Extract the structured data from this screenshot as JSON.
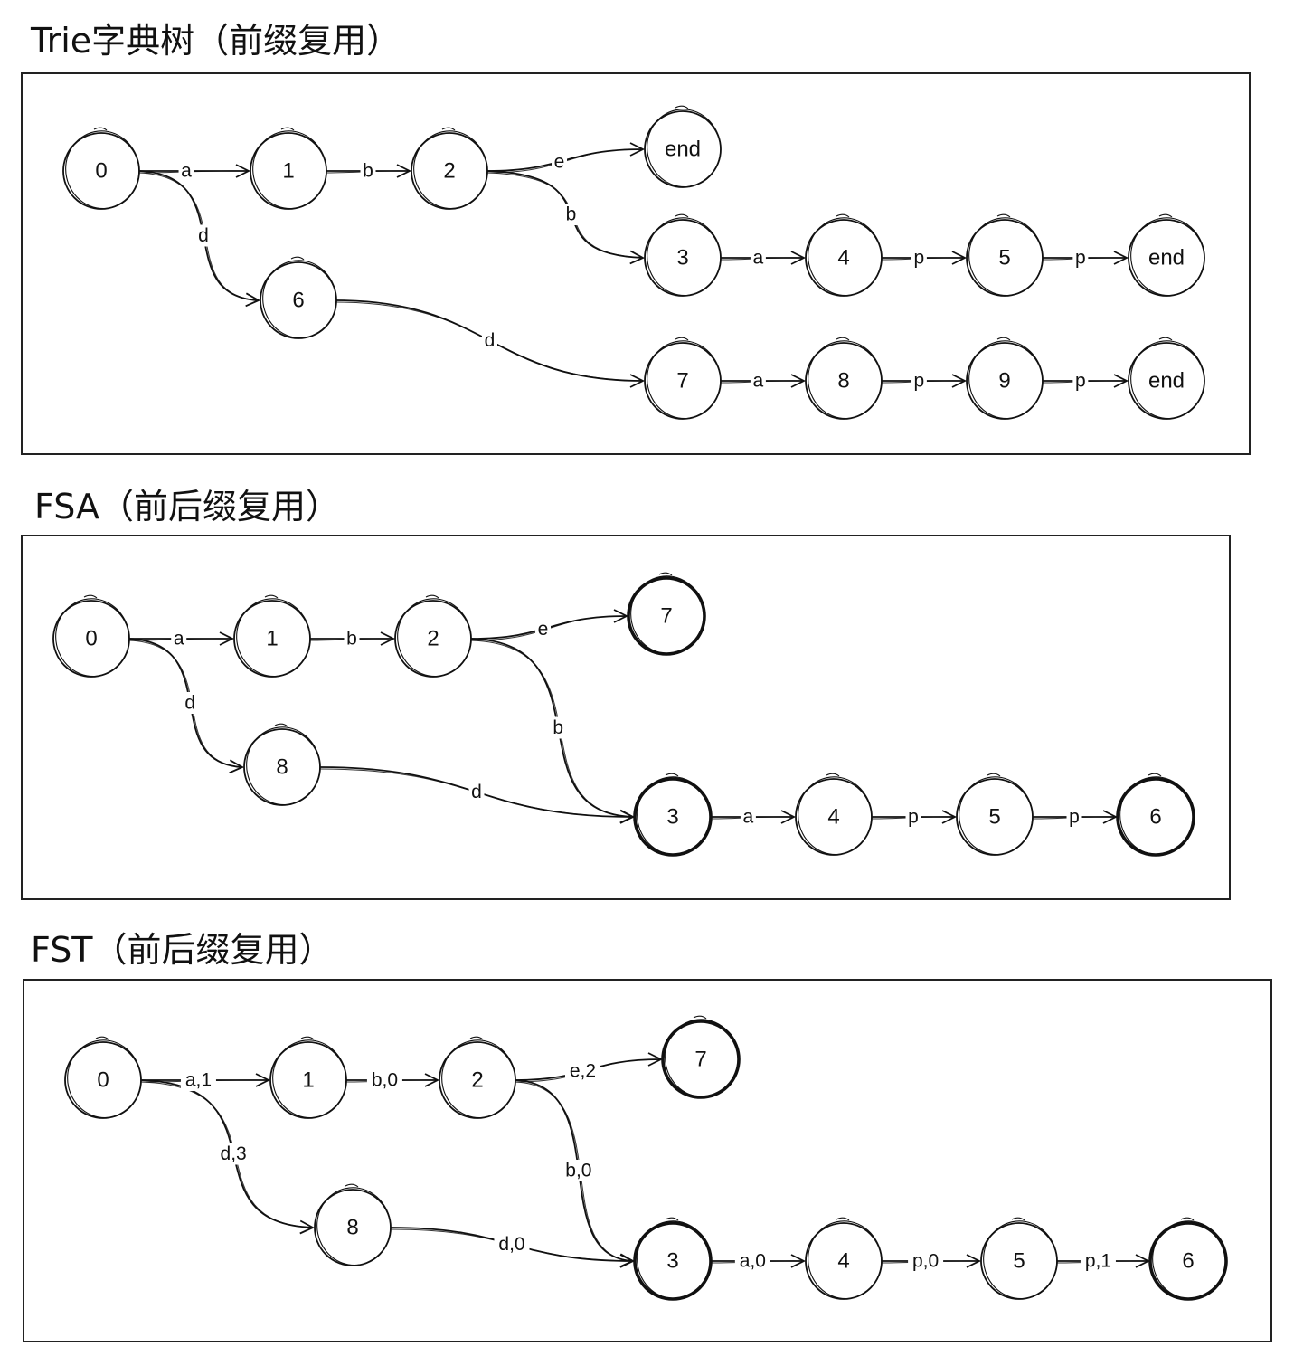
{
  "panels": [
    {
      "title": "Trie字典树（前缀复用）",
      "nodes": [
        {
          "id": "n0",
          "label": "0",
          "final": false
        },
        {
          "id": "n1",
          "label": "1",
          "final": false
        },
        {
          "id": "n2",
          "label": "2",
          "final": false
        },
        {
          "id": "nend1",
          "label": "end",
          "final": false
        },
        {
          "id": "n3",
          "label": "3",
          "final": false
        },
        {
          "id": "n4",
          "label": "4",
          "final": false
        },
        {
          "id": "n5",
          "label": "5",
          "final": false
        },
        {
          "id": "nend2",
          "label": "end",
          "final": false
        },
        {
          "id": "n6",
          "label": "6",
          "final": false
        },
        {
          "id": "n7",
          "label": "7",
          "final": false
        },
        {
          "id": "n8",
          "label": "8",
          "final": false
        },
        {
          "id": "n9",
          "label": "9",
          "final": false
        },
        {
          "id": "nend3",
          "label": "end",
          "final": false
        }
      ],
      "edges": [
        {
          "from": "n0",
          "to": "n1",
          "label": "a"
        },
        {
          "from": "n1",
          "to": "n2",
          "label": "b"
        },
        {
          "from": "n2",
          "to": "nend1",
          "label": "e"
        },
        {
          "from": "n2",
          "to": "n3",
          "label": "b"
        },
        {
          "from": "n3",
          "to": "n4",
          "label": "a"
        },
        {
          "from": "n4",
          "to": "n5",
          "label": "p"
        },
        {
          "from": "n5",
          "to": "nend2",
          "label": "p"
        },
        {
          "from": "n0",
          "to": "n6",
          "label": "d"
        },
        {
          "from": "n6",
          "to": "n7",
          "label": "d"
        },
        {
          "from": "n7",
          "to": "n8",
          "label": "a"
        },
        {
          "from": "n8",
          "to": "n9",
          "label": "p"
        },
        {
          "from": "n9",
          "to": "nend3",
          "label": "p"
        }
      ]
    },
    {
      "title": "FSA（前后缀复用）",
      "nodes": [
        {
          "id": "n0",
          "label": "0",
          "final": false
        },
        {
          "id": "n1",
          "label": "1",
          "final": false
        },
        {
          "id": "n2",
          "label": "2",
          "final": false
        },
        {
          "id": "n7",
          "label": "7",
          "final": true
        },
        {
          "id": "n8",
          "label": "8",
          "final": false
        },
        {
          "id": "n3",
          "label": "3",
          "final": true
        },
        {
          "id": "n4",
          "label": "4",
          "final": false
        },
        {
          "id": "n5",
          "label": "5",
          "final": false
        },
        {
          "id": "n6",
          "label": "6",
          "final": true
        }
      ],
      "edges": [
        {
          "from": "n0",
          "to": "n1",
          "label": "a"
        },
        {
          "from": "n1",
          "to": "n2",
          "label": "b"
        },
        {
          "from": "n2",
          "to": "n7",
          "label": "e"
        },
        {
          "from": "n2",
          "to": "n3",
          "label": "b"
        },
        {
          "from": "n0",
          "to": "n8",
          "label": "d"
        },
        {
          "from": "n8",
          "to": "n3",
          "label": "d"
        },
        {
          "from": "n3",
          "to": "n4",
          "label": "a"
        },
        {
          "from": "n4",
          "to": "n5",
          "label": "p"
        },
        {
          "from": "n5",
          "to": "n6",
          "label": "p"
        }
      ]
    },
    {
      "title": "FST（前后缀复用）",
      "nodes": [
        {
          "id": "n0",
          "label": "0",
          "final": false
        },
        {
          "id": "n1",
          "label": "1",
          "final": false
        },
        {
          "id": "n2",
          "label": "2",
          "final": false
        },
        {
          "id": "n7",
          "label": "7",
          "final": true
        },
        {
          "id": "n8",
          "label": "8",
          "final": false
        },
        {
          "id": "n3",
          "label": "3",
          "final": true
        },
        {
          "id": "n4",
          "label": "4",
          "final": false
        },
        {
          "id": "n5",
          "label": "5",
          "final": false
        },
        {
          "id": "n6",
          "label": "6",
          "final": true
        }
      ],
      "edges": [
        {
          "from": "n0",
          "to": "n1",
          "label": "a,1"
        },
        {
          "from": "n1",
          "to": "n2",
          "label": "b,0"
        },
        {
          "from": "n2",
          "to": "n7",
          "label": "e,2"
        },
        {
          "from": "n2",
          "to": "n3",
          "label": "b,0"
        },
        {
          "from": "n0",
          "to": "n8",
          "label": "d,3"
        },
        {
          "from": "n8",
          "to": "n3",
          "label": "d,0"
        },
        {
          "from": "n3",
          "to": "n4",
          "label": "a,0"
        },
        {
          "from": "n4",
          "to": "n5",
          "label": "p,0"
        },
        {
          "from": "n5",
          "to": "n6",
          "label": "p,1"
        }
      ]
    }
  ]
}
